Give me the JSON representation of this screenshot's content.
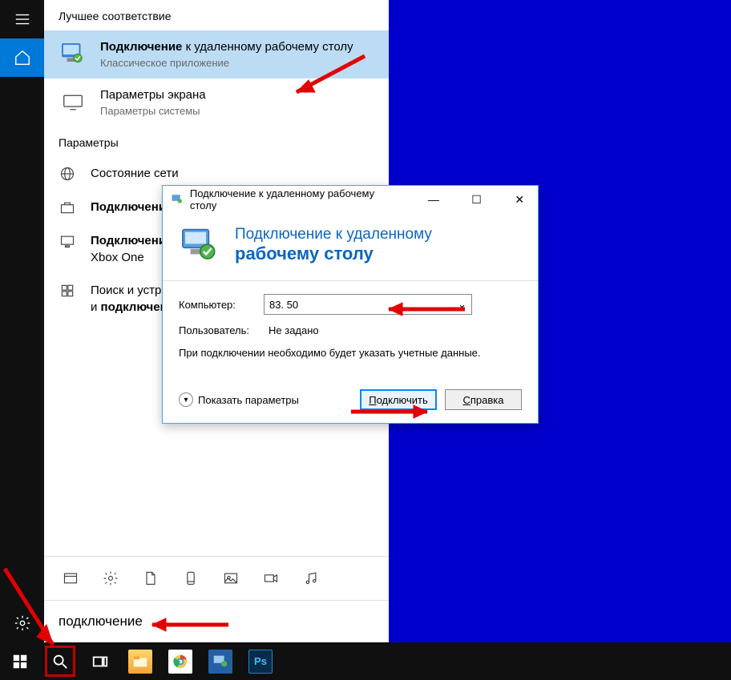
{
  "rail": {
    "hamburger": "menu-icon",
    "home": "home-icon",
    "settings": "settings-icon"
  },
  "start": {
    "best_match_header": "Лучшее соответствие",
    "result1": {
      "title_bold": "Подключение",
      "title_rest": " к удаленному рабочему столу",
      "sub": "Классическое приложение"
    },
    "result2": {
      "title": "Параметры экрана",
      "sub": "Параметры системы"
    },
    "params_header": "Параметры",
    "param_items": [
      {
        "text": "Состояние сети"
      },
      {
        "text_bold": "Подключение"
      },
      {
        "text_prefix": "Подключение",
        "text_rest_html": "<br>Xbox One"
      },
      {
        "text_a": "Поиск и устранен",
        "text_b": "и ",
        "text_b_bold": "подключени"
      }
    ],
    "search_query": "подключение"
  },
  "rdp": {
    "titlebar": "Подключение к удаленному рабочему столу",
    "banner_line1": "Подключение к удаленному",
    "banner_line2": "рабочему столу",
    "computer_label": "Компьютер:",
    "computer_value": "83.                  50",
    "user_label": "Пользователь:",
    "user_value": "Не задано",
    "hint": "При подключении необходимо будет указать учетные данные.",
    "show_params": "Показать параметры",
    "connect": "Подключить",
    "help": "Справка",
    "min": "—",
    "max": "☐",
    "close": "✕"
  },
  "taskbar": {
    "apps": [
      "explorer",
      "chrome",
      "rdp",
      "photoshop"
    ]
  }
}
